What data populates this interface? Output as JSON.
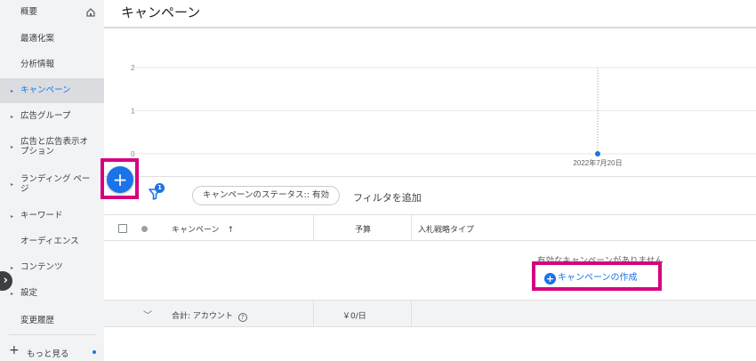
{
  "sidebar": {
    "items": [
      {
        "label": "概要",
        "arrow": ""
      },
      {
        "label": "最適化案",
        "arrow": ""
      },
      {
        "label": "分析情報",
        "arrow": ""
      },
      {
        "label": "キャンペーン",
        "arrow": "▸"
      },
      {
        "label": "広告グループ",
        "arrow": "▸"
      },
      {
        "label": "広告と広告表示オ",
        "label2": "プション",
        "arrow": "▸"
      },
      {
        "label": "ランディング ペー",
        "label2": "ジ",
        "arrow": "▸"
      },
      {
        "label": "キーワード",
        "arrow": "▸"
      },
      {
        "label": "オーディエンス",
        "arrow": ""
      },
      {
        "label": "コンテンツ",
        "arrow": "▸"
      },
      {
        "label": "設定",
        "arrow": "▸"
      },
      {
        "label": "変更履歴",
        "arrow": ""
      }
    ],
    "more_label": "もっと見る",
    "collapse_icon": "chevron-right-icon",
    "more_icon": "plus-icon",
    "home_icon": "home-icon"
  },
  "header": {
    "title": "キャンペーン"
  },
  "chart_data": {
    "type": "line",
    "yticks": [
      "2",
      "1",
      "0"
    ],
    "ylim": [
      0,
      2
    ],
    "x": [
      "2022年7月20日"
    ],
    "series": [
      {
        "values": [
          0
        ]
      }
    ],
    "grid": true,
    "accent": "#1a73e8"
  },
  "toolbar": {
    "add_icon": "plus-icon",
    "filter_icon": "filter-icon",
    "filter_badge": "1",
    "status_chip": "キャンペーンのステータス:: 有効",
    "add_filter": "フィルタを追加"
  },
  "table": {
    "col_campaign": "キャンペーン",
    "sort_arrow": "↑",
    "col_budget": "予算",
    "col_bid": "入札戦略タイプ",
    "empty_message": "有効なキャンペーンがありません",
    "create_label": "キャンペーンの作成",
    "total_label": "合計: アカウント",
    "total_budget": "￥0/日"
  },
  "highlight_color": "#d6007f"
}
